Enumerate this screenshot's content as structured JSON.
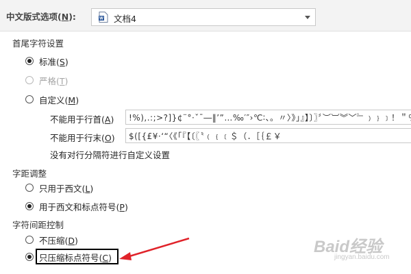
{
  "top": {
    "label_prefix": "中文版式选项(",
    "label_key": "N",
    "label_suffix": "):",
    "document": "文档4"
  },
  "line_break": {
    "title": "首尾字符设置",
    "options": [
      {
        "prefix": "标准(",
        "key": "S",
        "suffix": ")",
        "checked": true,
        "disabled": false
      },
      {
        "prefix": "严格(",
        "key": "T",
        "suffix": ")",
        "checked": false,
        "disabled": true
      },
      {
        "prefix": "自定义(",
        "key": "M",
        "suffix": ")",
        "checked": false,
        "disabled": false
      }
    ],
    "not_first_label_prefix": "不能用于行首(",
    "not_first_label_key": "A",
    "not_first_label_suffix": ")",
    "not_first_chars": "!%),.:;>?]}¢¨°·ˇˉ―‖’”…‰′″›℃∶、。〃〉》」』】〕〗〞︶︺︾﹀﹄﹚﹜﹞！＂％＇），．：；？］｝～",
    "not_last_label_prefix": "不能用于行末(",
    "not_last_label_key": "O",
    "not_last_label_suffix": ")",
    "not_last_chars": "$([{£¥·‘“〈《「『【〔〖〝﹙﹛﹝＄（．［｛￡￥",
    "note": "没有对行分隔符进行自定义设置"
  },
  "kerning": {
    "title": "字距调整",
    "options": [
      {
        "prefix": "只用于西文(",
        "key": "L",
        "suffix": ")",
        "checked": false
      },
      {
        "prefix": "用于西文和标点符号(",
        "key": "P",
        "suffix": ")",
        "checked": true
      }
    ]
  },
  "spacing": {
    "title": "字符间距控制",
    "options": [
      {
        "prefix": "不压缩(",
        "key": "D",
        "suffix": ")",
        "checked": false
      },
      {
        "prefix": "只压缩标点符号(",
        "key": "C",
        "suffix": ")",
        "checked": true
      }
    ]
  },
  "watermark": {
    "brand": "Baid经验",
    "url": "jingyan.baidu.com"
  },
  "colors": {
    "arrow": "#e0232a"
  }
}
